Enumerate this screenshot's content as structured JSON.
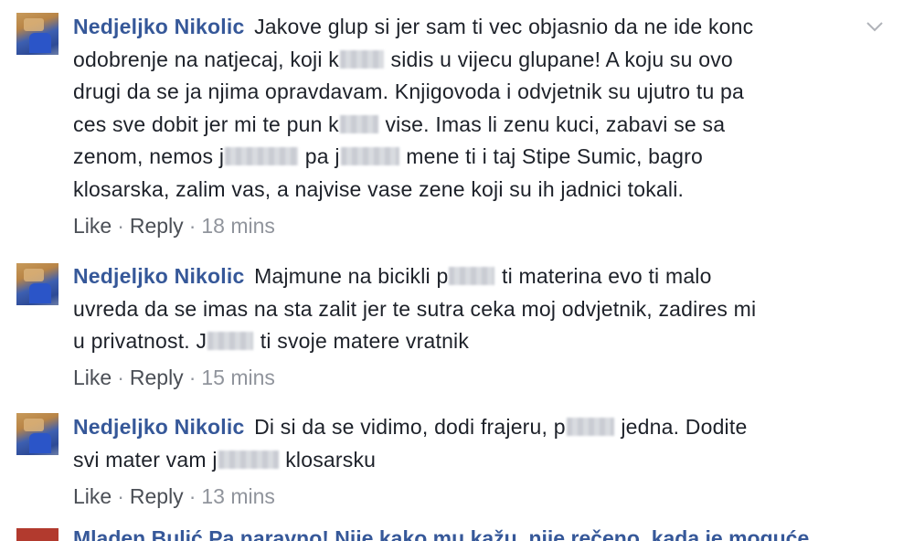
{
  "comments": [
    {
      "author": "Nedjeljko Nikolic",
      "lines": [
        [
          "Jakove glup si jer sam ti vec objasnio da ne ide konc"
        ],
        [
          "odobrenje na natjecaj, koji k",
          "sidis u vijecu glupane! A koju su ovo"
        ],
        [
          "drugi da se ja njima opravdavam. Knjigovoda i odvjetnik su ujutro tu pa"
        ],
        [
          "ces sve dobit jer mi te pun k",
          "vise. Imas li zenu kuci, zabavi se sa"
        ],
        [
          "zenom, nemos j",
          "pa j",
          "mene ti i taj Stipe Sumic, bagro"
        ],
        [
          "klosarska, zalim vas, a najvise vase zene koji su ih jadnici tokali."
        ]
      ],
      "like": "Like",
      "reply": "Reply",
      "time": "18 mins"
    },
    {
      "author": "Nedjeljko Nikolic",
      "lines": [
        [
          "Majmune na bicikli p",
          "ti materina evo ti malo"
        ],
        [
          "uvreda da se imas na sta zalit jer te sutra ceka moj odvjetnik, zadires mi"
        ],
        [
          "u privatnost. J",
          "ti svoje matere vratnik"
        ]
      ],
      "like": "Like",
      "reply": "Reply",
      "time": "15 mins"
    },
    {
      "author": "Nedjeljko Nikolic",
      "lines": [
        [
          "Di si da se vidimo, dodi frajeru, p",
          "jedna. Dodite"
        ],
        [
          "svi mater vam j",
          "klosarsku"
        ]
      ],
      "like": "Like",
      "reply": "Reply",
      "time": "13 mins"
    }
  ],
  "partial_comment": {
    "text": "Mladen Bulić  Pa naravno! Nije kako mu kažu, nije rečeno, kada je moguće"
  },
  "icons": {
    "options": "chevron-down-icon"
  },
  "colors": {
    "author": "#365899",
    "meta": "#90949c"
  }
}
